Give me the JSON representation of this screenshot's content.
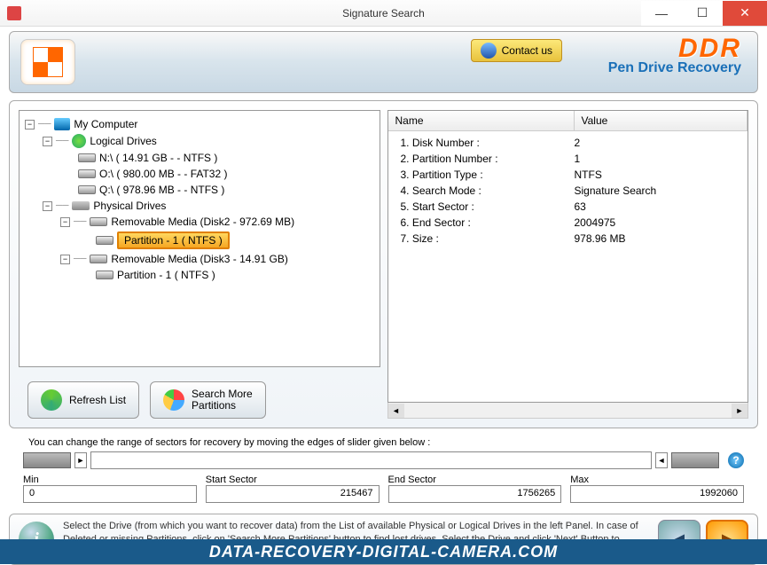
{
  "window": {
    "title": "Signature Search"
  },
  "header": {
    "contact": "Contact us",
    "brand": "DDR",
    "subtitle": "Pen Drive Recovery"
  },
  "tree": {
    "root": "My Computer",
    "logical_label": "Logical Drives",
    "logical": [
      "N:\\ ( 14.91 GB -  - NTFS )",
      "O:\\ ( 980.00 MB -  - FAT32 )",
      "Q:\\ ( 978.96 MB -  - NTFS )"
    ],
    "physical_label": "Physical Drives",
    "removable1": "Removable Media  (Disk2 - 972.69 MB)",
    "partition1": "Partition - 1 ( NTFS )",
    "removable2": "Removable Media  (Disk3 - 14.91 GB)",
    "partition2": "Partition - 1 ( NTFS )"
  },
  "props": {
    "col_name": "Name",
    "col_value": "Value",
    "rows": [
      {
        "n": "1. Disk Number :",
        "v": "2"
      },
      {
        "n": "2. Partition Number :",
        "v": "1"
      },
      {
        "n": "3. Partition Type :",
        "v": "NTFS"
      },
      {
        "n": "4. Search Mode :",
        "v": "Signature Search"
      },
      {
        "n": "5. Start Sector :",
        "v": "63"
      },
      {
        "n": "6. End Sector :",
        "v": "2004975"
      },
      {
        "n": "7. Size :",
        "v": "978.96 MB"
      }
    ]
  },
  "buttons": {
    "refresh": "Refresh List",
    "search_more": "Search More\nPartitions"
  },
  "slider": {
    "hint": "You can change the range of sectors for recovery by moving the edges of slider given below :",
    "min_label": "Min",
    "min_val": "0",
    "start_label": "Start Sector",
    "start_val": "215467",
    "end_label": "End Sector",
    "end_val": "1756265",
    "max_label": "Max",
    "max_val": "1992060"
  },
  "footer": {
    "text": "Select the Drive (from which you want to recover data) from the List of available Physical or Logical Drives in the left Panel. In case of Deleted or missing Partitions, click on 'Search More Partitions' button to find lost drives. Select the Drive and click 'Next' Button to continue..."
  },
  "watermark": "DATA-RECOVERY-DIGITAL-CAMERA.COM"
}
